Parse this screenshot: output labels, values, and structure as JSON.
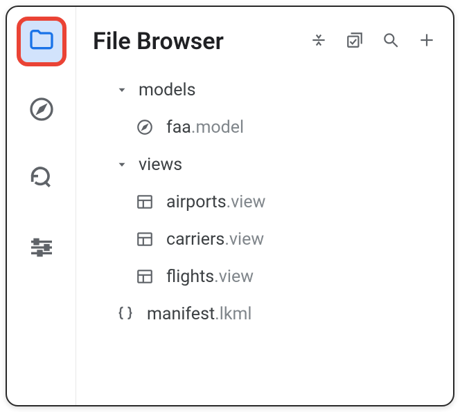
{
  "header": {
    "title": "File Browser"
  },
  "sidebar": {
    "items": [
      {
        "name": "folder",
        "active": true
      },
      {
        "name": "compass",
        "active": false
      },
      {
        "name": "history-search",
        "active": false
      },
      {
        "name": "sliders",
        "active": false
      }
    ]
  },
  "toolbar": {
    "icons": [
      "collapse",
      "bulk-check",
      "search",
      "add"
    ]
  },
  "tree": {
    "folders": [
      {
        "name": "models",
        "expanded": true,
        "children": [
          {
            "base": "faa",
            "ext": ".model",
            "icon": "compass"
          }
        ]
      },
      {
        "name": "views",
        "expanded": true,
        "children": [
          {
            "base": "airports",
            "ext": ".view",
            "icon": "table"
          },
          {
            "base": "carriers",
            "ext": ".view",
            "icon": "table"
          },
          {
            "base": "flights",
            "ext": ".view",
            "icon": "table"
          }
        ]
      }
    ],
    "root_files": [
      {
        "base": "manifest",
        "ext": ".lkml",
        "icon": "braces"
      }
    ]
  }
}
